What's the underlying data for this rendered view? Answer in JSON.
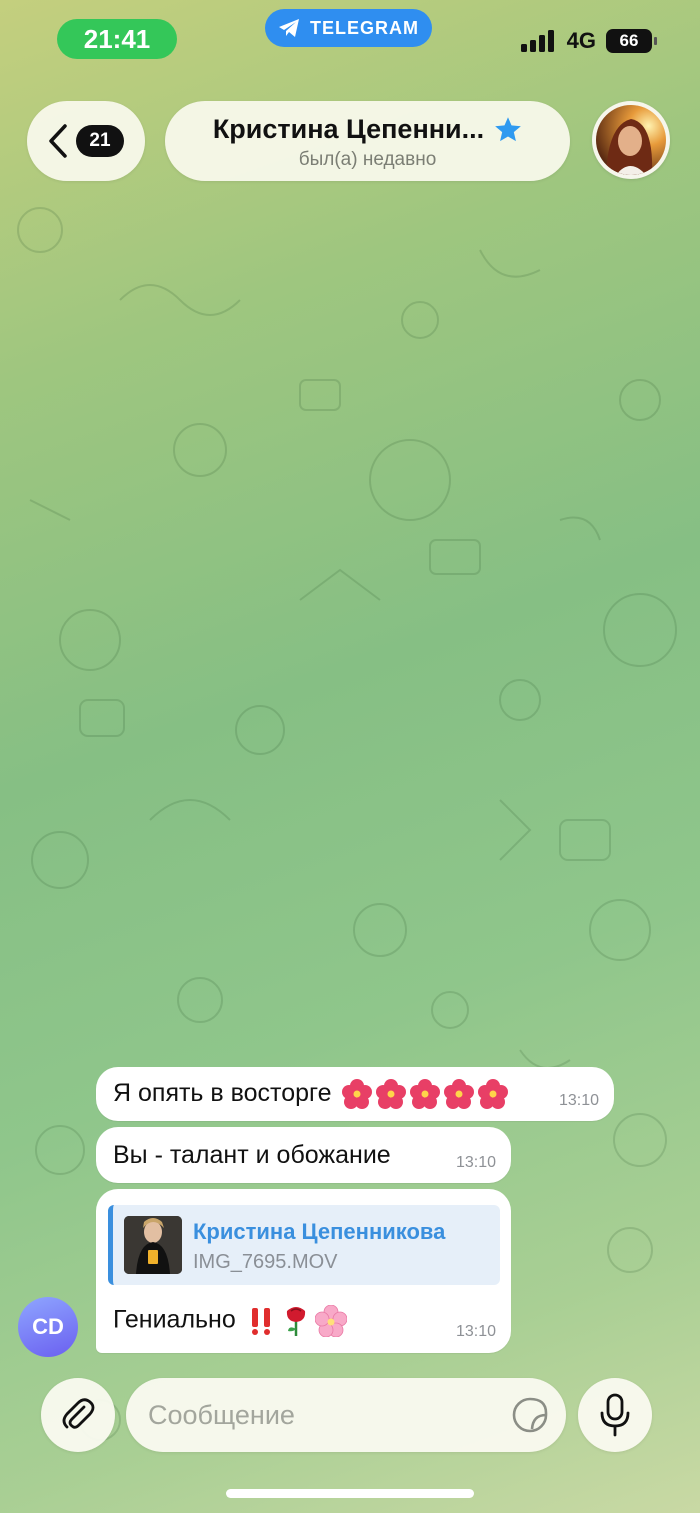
{
  "status_bar": {
    "time": "21:41",
    "app_pill": "TELEGRAM",
    "network": "4G",
    "battery": "66",
    "signal_icon": "signal-bars-icon"
  },
  "header": {
    "back_icon": "chevron-left-icon",
    "unread_count": "21",
    "title": "Кристина Цепенни...",
    "subtitle": "был(а) недавно",
    "star_icon": "star-icon",
    "star_color": "#2f9af0"
  },
  "messages": [
    {
      "text": "Я опять в восторге",
      "emoji": [
        "hibiscus",
        "hibiscus",
        "hibiscus",
        "hibiscus",
        "hibiscus"
      ],
      "time": "13:10"
    },
    {
      "text": "Вы - талант и обожание",
      "time": "13:10"
    },
    {
      "reply": {
        "name": "Кристина Цепенникова",
        "file": "IMG_7695.MOV"
      },
      "text": "Гениально",
      "emoji": [
        "double-exclamation",
        "rose",
        "cherry-blossom"
      ],
      "time": "13:10"
    }
  ],
  "sender_avatar_initials": "CD",
  "input": {
    "placeholder": "Сообщение",
    "attach_icon": "paperclip-icon",
    "sticker_icon": "sticker-icon",
    "mic_icon": "microphone-icon"
  },
  "colors": {
    "accent": "#3a8fde",
    "status_green": "#34c759",
    "telegram_blue": "#2f8ef0"
  }
}
